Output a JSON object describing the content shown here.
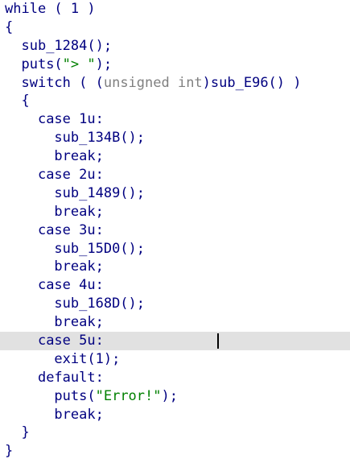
{
  "editor": {
    "lines": [
      {
        "indent": "",
        "parts": [
          {
            "t": "while ( 1 )",
            "c": "kw"
          }
        ]
      },
      {
        "indent": "",
        "parts": [
          {
            "t": "{",
            "c": "punct"
          }
        ]
      },
      {
        "indent": "  ",
        "parts": [
          {
            "t": "sub_1284();",
            "c": "call"
          }
        ]
      },
      {
        "indent": "  ",
        "parts": [
          {
            "t": "puts(",
            "c": "call"
          },
          {
            "t": "\"> \"",
            "c": "str"
          },
          {
            "t": ");",
            "c": "punct"
          }
        ]
      },
      {
        "indent": "  ",
        "parts": [
          {
            "t": "switch ( (",
            "c": "kw"
          },
          {
            "t": "unsigned int",
            "c": "type"
          },
          {
            "t": ")sub_E96() )",
            "c": "call"
          }
        ]
      },
      {
        "indent": "  ",
        "parts": [
          {
            "t": "{",
            "c": "punct"
          }
        ]
      },
      {
        "indent": "    ",
        "parts": [
          {
            "t": "case 1u:",
            "c": "kw"
          }
        ]
      },
      {
        "indent": "      ",
        "parts": [
          {
            "t": "sub_134B();",
            "c": "call"
          }
        ]
      },
      {
        "indent": "      ",
        "parts": [
          {
            "t": "break;",
            "c": "kw"
          }
        ]
      },
      {
        "indent": "    ",
        "parts": [
          {
            "t": "case 2u:",
            "c": "kw"
          }
        ]
      },
      {
        "indent": "      ",
        "parts": [
          {
            "t": "sub_1489();",
            "c": "call"
          }
        ]
      },
      {
        "indent": "      ",
        "parts": [
          {
            "t": "break;",
            "c": "kw"
          }
        ]
      },
      {
        "indent": "    ",
        "parts": [
          {
            "t": "case 3u:",
            "c": "kw"
          }
        ]
      },
      {
        "indent": "      ",
        "parts": [
          {
            "t": "sub_15D0();",
            "c": "call"
          }
        ]
      },
      {
        "indent": "      ",
        "parts": [
          {
            "t": "break;",
            "c": "kw"
          }
        ]
      },
      {
        "indent": "    ",
        "parts": [
          {
            "t": "case 4u:",
            "c": "kw"
          }
        ]
      },
      {
        "indent": "      ",
        "parts": [
          {
            "t": "sub_168D();",
            "c": "call"
          }
        ]
      },
      {
        "indent": "      ",
        "parts": [
          {
            "t": "break;",
            "c": "kw"
          }
        ]
      },
      {
        "indent": "    ",
        "parts": [
          {
            "t": "case 5u:",
            "c": "kw"
          }
        ],
        "highlight": true,
        "caret": true
      },
      {
        "indent": "      ",
        "parts": [
          {
            "t": "exit(1);",
            "c": "call"
          }
        ]
      },
      {
        "indent": "    ",
        "parts": [
          {
            "t": "default:",
            "c": "kw"
          }
        ]
      },
      {
        "indent": "      ",
        "parts": [
          {
            "t": "puts(",
            "c": "call"
          },
          {
            "t": "\"Error!\"",
            "c": "str"
          },
          {
            "t": ");",
            "c": "punct"
          }
        ]
      },
      {
        "indent": "      ",
        "parts": [
          {
            "t": "break;",
            "c": "kw"
          }
        ]
      },
      {
        "indent": "  ",
        "parts": [
          {
            "t": "}",
            "c": "punct"
          }
        ]
      },
      {
        "indent": "",
        "parts": [
          {
            "t": "}",
            "c": "punct"
          }
        ]
      }
    ]
  },
  "colors": {
    "code_text": "#000080",
    "string_literal": "#008000",
    "type_cast": "#808080",
    "current_line_highlight": "#e1e1e1",
    "background": "#ffffff"
  }
}
